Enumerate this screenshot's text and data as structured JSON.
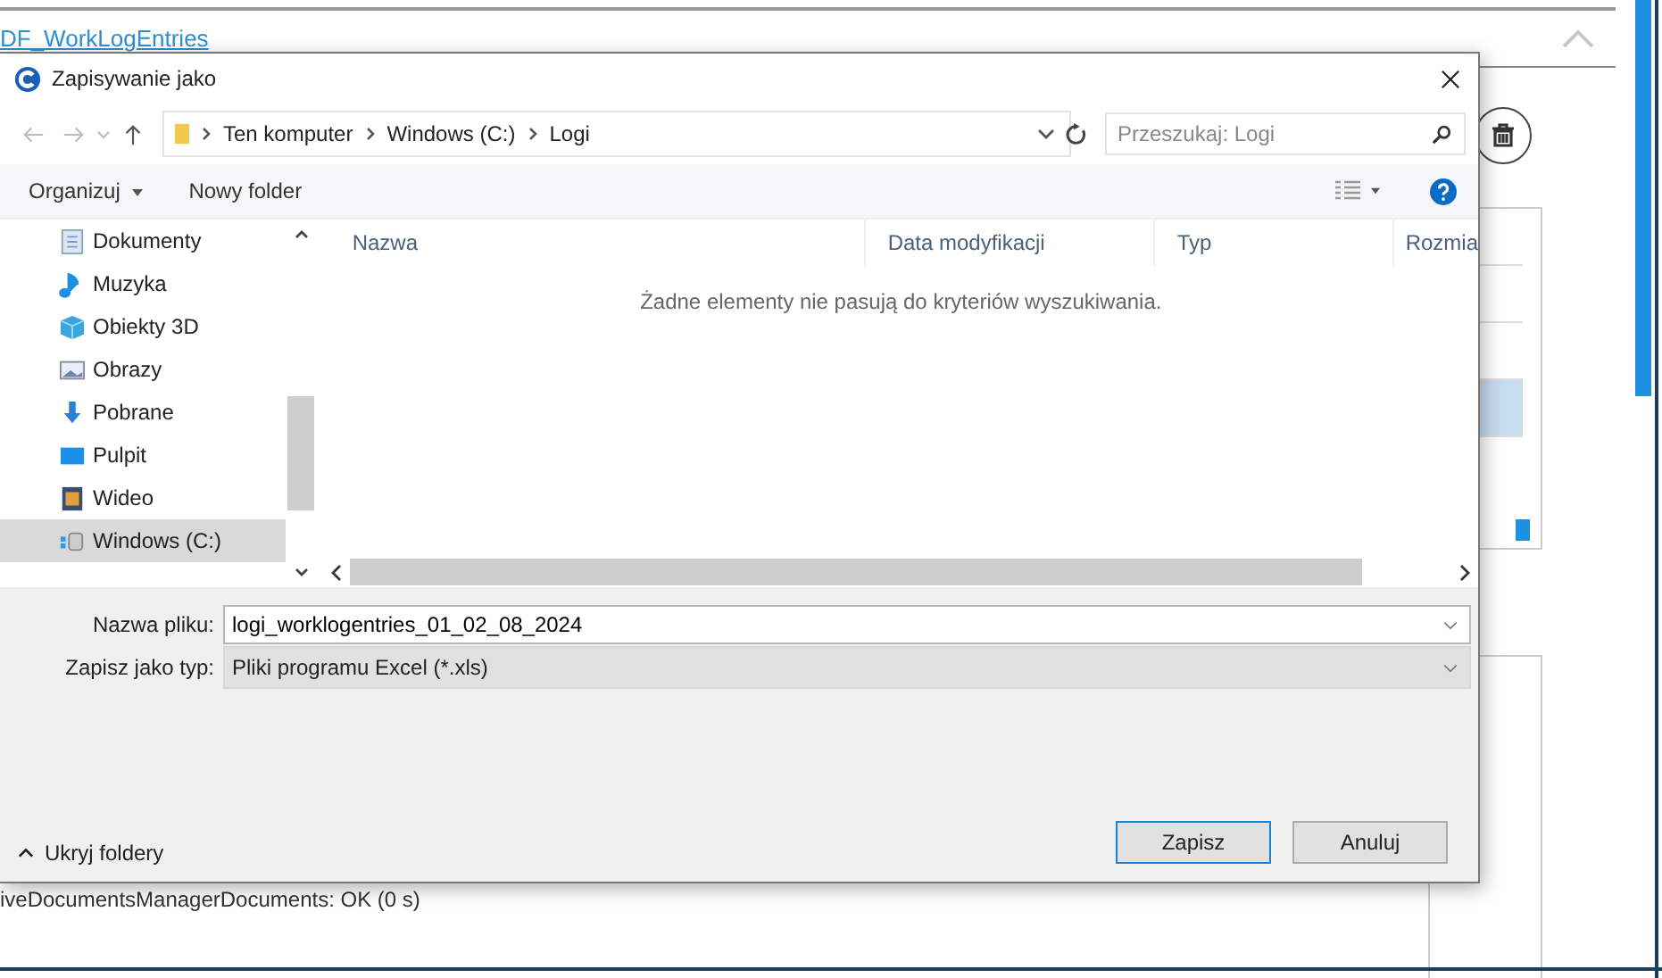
{
  "page": {
    "section_title": "DF_WorkLogEntries",
    "status_text": "iveDocumentsManagerDocuments: OK (0 s)"
  },
  "dialog": {
    "title": "Zapisywanie jako",
    "breadcrumb": [
      "Ten komputer",
      "Windows (C:)",
      "Logi"
    ],
    "search": {
      "placeholder": "Przeszukaj: Logi"
    },
    "toolbar": [
      "Organizuj",
      "Nowy folder"
    ],
    "nav_items": [
      {
        "label": "Dokumenty",
        "kind": "documents",
        "selected": false
      },
      {
        "label": "Muzyka",
        "kind": "music",
        "selected": false
      },
      {
        "label": "Obiekty 3D",
        "kind": "cube",
        "selected": false
      },
      {
        "label": "Obrazy",
        "kind": "pictures",
        "selected": false
      },
      {
        "label": "Pobrane",
        "kind": "download",
        "selected": false
      },
      {
        "label": "Pulpit",
        "kind": "desktop",
        "selected": false
      },
      {
        "label": "Wideo",
        "kind": "video",
        "selected": false
      },
      {
        "label": "Windows (C:)",
        "kind": "drive",
        "selected": true
      }
    ],
    "columns": [
      "Nazwa",
      "Data modyfikacji",
      "Typ",
      "Rozmia"
    ],
    "empty_message": "Żadne elementy nie pasują do kryteriów wyszukiwania.",
    "file_name": {
      "label": "Nazwa pliku:",
      "value": "logi_worklogentries_01_02_08_2024"
    },
    "file_type": {
      "label": "Zapisz jako typ:",
      "value": "Pliki programu Excel (*.xls)"
    },
    "hide_folders": "Ukryj foldery",
    "buttons": [
      {
        "label": "Zapisz",
        "default": true
      },
      {
        "label": "Anuluj",
        "default": false
      }
    ]
  }
}
